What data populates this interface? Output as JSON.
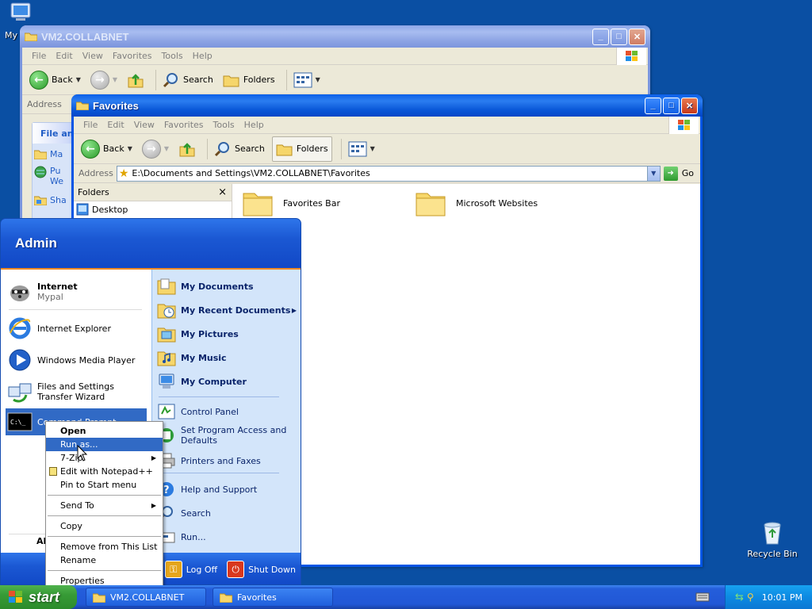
{
  "desktop": {
    "icons": [
      {
        "label": "My",
        "icon": "my-computer-icon"
      },
      {
        "label": "Recycle Bin",
        "icon": "recycle-bin-icon"
      }
    ]
  },
  "window_back": {
    "title": "VM2.COLLABNET",
    "menu": [
      "File",
      "Edit",
      "View",
      "Favorites",
      "Tools",
      "Help"
    ],
    "toolbar": {
      "back": "Back",
      "search": "Search",
      "folders": "Folders"
    },
    "address_label": "Address",
    "task_pane_title": "File an",
    "task_items": [
      "Ma",
      "Pu",
      "We",
      "Sha"
    ]
  },
  "window_front": {
    "title": "Favorites",
    "menu": [
      "File",
      "Edit",
      "View",
      "Favorites",
      "Tools",
      "Help"
    ],
    "toolbar": {
      "back": "Back",
      "search": "Search",
      "folders": "Folders"
    },
    "address_label": "Address",
    "address_value": "E:\\Documents and Settings\\VM2.COLLABNET\\Favorites",
    "go_label": "Go",
    "folders_pane_title": "Folders",
    "folders_close": "×",
    "folders_tree": [
      "Desktop"
    ],
    "items": [
      "Favorites Bar",
      "Microsoft Websites"
    ]
  },
  "start_menu": {
    "user": "Admin",
    "pinned": [
      {
        "title": "Internet",
        "subtitle": "Mypal"
      }
    ],
    "recent": [
      "Internet Explorer",
      "Windows Media Player",
      "Files and Settings Transfer Wizard",
      "Command Prompt"
    ],
    "all_programs": "All",
    "right": {
      "my_documents": "My Documents",
      "my_recent_documents": "My Recent Documents",
      "my_pictures": "My Pictures",
      "my_music": "My Music",
      "my_computer": "My Computer",
      "control_panel": "Control Panel",
      "set_program_access": "Set Program Access and Defaults",
      "printers_and_faxes": "Printers and Faxes",
      "help_and_support": "Help and Support",
      "search": "Search",
      "run": "Run..."
    },
    "log_off": "Log Off",
    "shut_down": "Shut Down"
  },
  "context_menu": {
    "open": "Open",
    "run_as": "Run as...",
    "seven_zip": "7-Zip",
    "edit_notepad": "Edit with Notepad++",
    "pin_start": "Pin to Start menu",
    "send_to": "Send To",
    "copy": "Copy",
    "remove_from_list": "Remove from This List",
    "rename": "Rename",
    "properties": "Properties"
  },
  "taskbar": {
    "start": "start",
    "tasks": [
      "VM2.COLLABNET",
      "Favorites"
    ],
    "clock": "10:01 PM"
  },
  "colors": {
    "desktop": "#0a4fa3",
    "titlebar_active": "#0a57d8",
    "titlebar_inactive": "#8ca3e4",
    "highlight": "#316ac5",
    "start_green": "#379b36",
    "tray": "#0d8ae2"
  }
}
